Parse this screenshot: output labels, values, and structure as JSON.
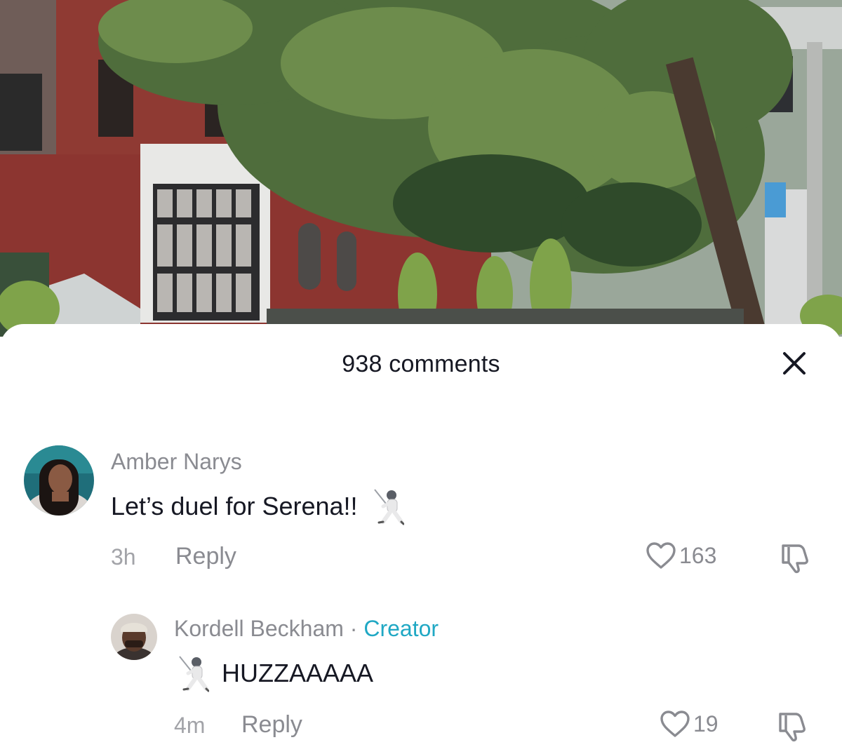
{
  "sheet": {
    "title": "938 comments"
  },
  "comments": [
    {
      "username": "Amber Narys",
      "text": "Let’s duel for Serena!!",
      "emoji_icon": "fencer-icon",
      "time": "3h",
      "reply_label": "Reply",
      "likes": "163"
    },
    {
      "username": "Kordell Beckham",
      "separator": "·",
      "badge": "Creator",
      "text": "HUZZAAAAA",
      "emoji_icon": "fencer-icon",
      "time": "4m",
      "reply_label": "Reply",
      "likes": "19"
    }
  ],
  "colors": {
    "creator_badge": "#20a8c4",
    "text_primary": "#161823",
    "text_secondary": "#8a8b91"
  }
}
